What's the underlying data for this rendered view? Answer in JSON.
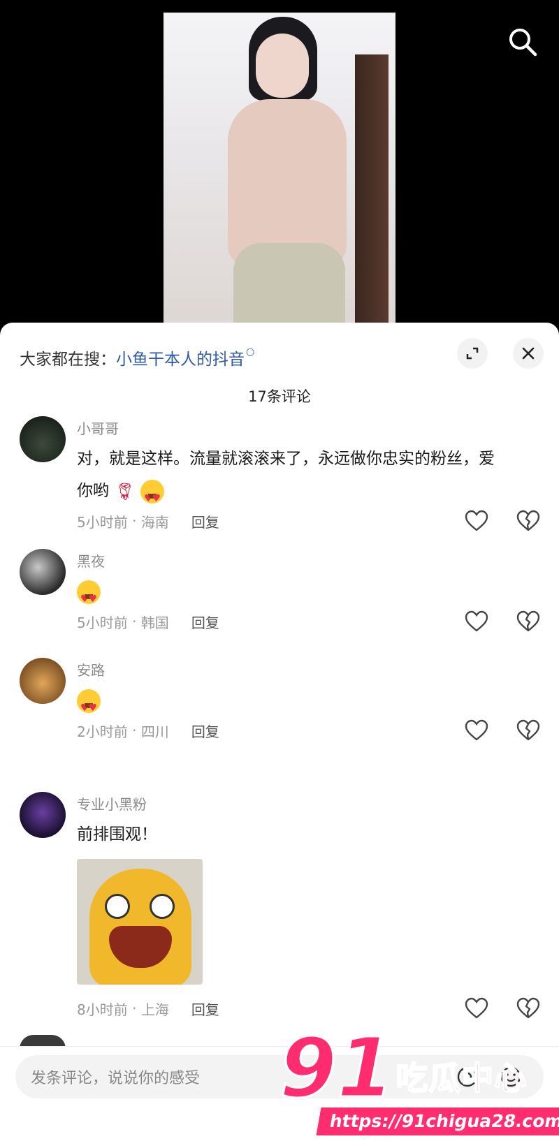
{
  "search_sheet": {
    "prefix": "大家都在搜：",
    "keyword": "小鱼干本人的抖音"
  },
  "comment_count_title": "17条评论",
  "comments": [
    {
      "user": "小哥哥",
      "text": "对，就是这样。流量就滚滚来了，永远做你忠实的粉丝，爱你哟",
      "emojis": [
        "rose",
        "heart-eyes"
      ],
      "time": "5小时前",
      "location": "海南",
      "reply": "回复"
    },
    {
      "user": "黑夜",
      "text": "",
      "emojis": [
        "heart-eyes"
      ],
      "time": "5小时前",
      "location": "韩国",
      "reply": "回复"
    },
    {
      "user": "安路",
      "text": "",
      "emojis": [
        "heart-eyes"
      ],
      "time": "2小时前",
      "location": "四川",
      "reply": "回复"
    },
    {
      "user": "专业小黑粉",
      "text": "前排围观！",
      "emojis": [],
      "time": "8小时前",
      "location": "上海",
      "reply": "回复"
    }
  ],
  "comment_input": {
    "placeholder": "发条评论，说说你的感受"
  },
  "watermark": {
    "number": "91",
    "text": "吃瓜中心",
    "url": "https://91chigua28.com"
  },
  "colors": {
    "accent_link": "#2f5aa8",
    "watermark": "#ff2d6f"
  }
}
